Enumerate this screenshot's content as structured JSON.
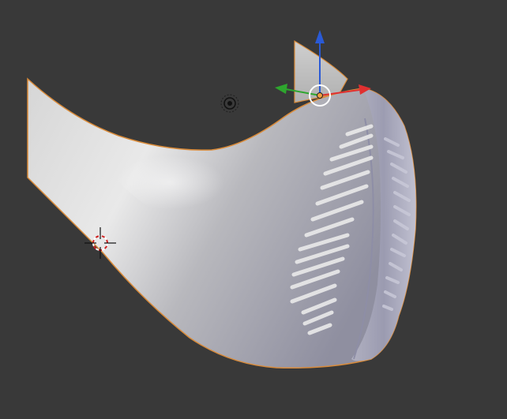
{
  "viewport": {
    "background": "#393939",
    "selection_outline": "#d98b3a",
    "mesh_base_color": "#c8c8c8",
    "mesh_shadow_color": "#9a9aa6",
    "axis_colors": {
      "x": "#e03030",
      "y": "#2ea62e",
      "z": "#2a5ad6"
    }
  },
  "objects": {
    "mesh": {
      "icon": "mask-mesh",
      "selected": true
    },
    "gizmo": {
      "icon": "transform-gizmo"
    },
    "cursor": {
      "icon": "3d-cursor-icon"
    },
    "light": {
      "icon": "light-icon"
    }
  }
}
